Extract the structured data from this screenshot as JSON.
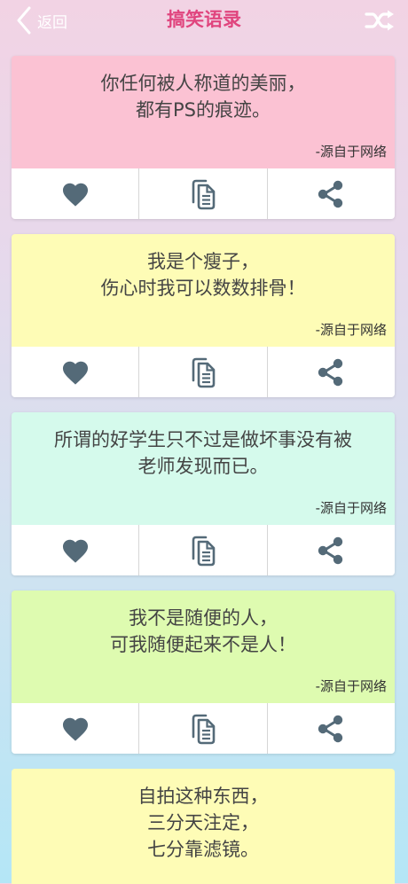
{
  "header": {
    "back_label": "返回",
    "title": "搞笑语录",
    "back_icon": "chevron-left-icon",
    "shuffle_icon": "shuffle-icon"
  },
  "colors": {
    "title": "#e0457e",
    "icon": "#546a78",
    "card_pink": "#fbc2d3",
    "card_yellow": "#fefcb6",
    "card_mint": "#d5faec",
    "card_lime": "#defbb0",
    "card_yellow_2": "#fefcb6"
  },
  "cards": [
    {
      "quote": "你任何被人称道的美丽，\n都有PS的痕迹。",
      "source": "-源自于网络"
    },
    {
      "quote": "我是个瘦子，\n伤心时我可以数数排骨！",
      "source": "-源自于网络"
    },
    {
      "quote": "所谓的好学生只不过是做坏事没有被\n老师发现而已。",
      "source": "-源自于网络"
    },
    {
      "quote": "我不是随便的人，\n可我随便起来不是人！",
      "source": "-源自于网络"
    },
    {
      "quote": "自拍这种东西，\n三分天注定，\n七分靠滤镜。"
    }
  ],
  "actions": {
    "like_icon": "heart-icon",
    "copy_icon": "copy-icon",
    "share_icon": "share-icon"
  }
}
